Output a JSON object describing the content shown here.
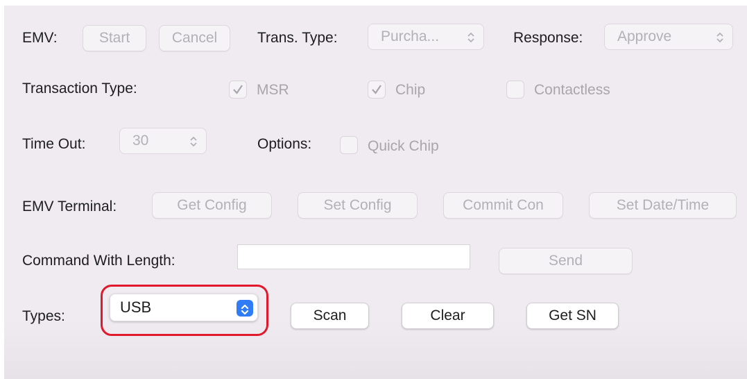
{
  "emv_row": {
    "label": "EMV:",
    "start_label": "Start",
    "cancel_label": "Cancel",
    "trans_type_label": "Trans. Type:",
    "trans_type_value": "Purcha...",
    "response_label": "Response:",
    "response_value": "Approve"
  },
  "transaction_type_row": {
    "label": "Transaction Type:",
    "options": [
      {
        "label": "MSR",
        "checked": true
      },
      {
        "label": "Chip",
        "checked": true
      },
      {
        "label": "Contactless",
        "checked": false
      }
    ]
  },
  "timeout_row": {
    "label": "Time Out:",
    "value": "30",
    "options_label": "Options:",
    "quick_chip_label": "Quick Chip",
    "quick_chip_checked": false
  },
  "emv_terminal_row": {
    "label": "EMV Terminal:",
    "buttons": [
      "Get Config",
      "Set Config",
      "Commit Con",
      "Set Date/Time"
    ]
  },
  "command_row": {
    "label": "Command With Length:",
    "input_value": "",
    "send_label": "Send"
  },
  "types_row": {
    "label": "Types:",
    "selected": "USB",
    "scan_label": "Scan",
    "clear_label": "Clear",
    "get_sn_label": "Get SN"
  },
  "colors": {
    "panel_bg": "#efebf1",
    "accent_blue": "#2f7cf6",
    "highlight_red": "#e0192d",
    "disabled_text": "#b3b0b6"
  }
}
